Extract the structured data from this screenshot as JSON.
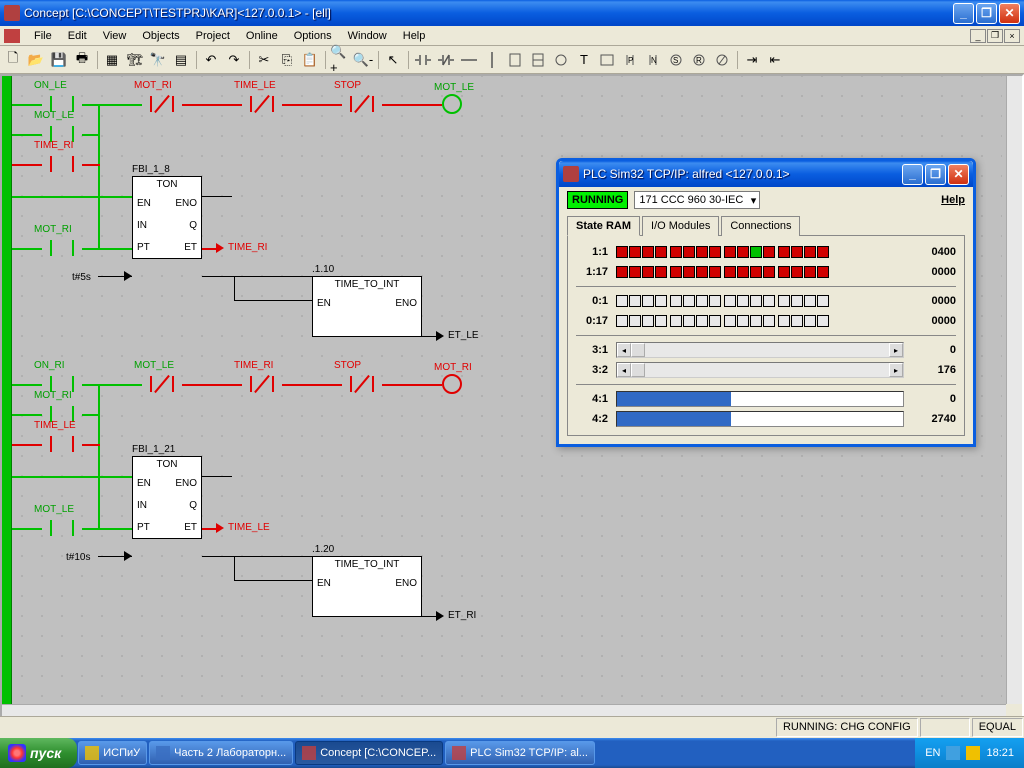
{
  "app": {
    "title": "Concept [C:\\CONCEPT\\TESTPRJ\\KAR]<127.0.0.1> - [ell]"
  },
  "menu": [
    "File",
    "Edit",
    "View",
    "Objects",
    "Project",
    "Online",
    "Options",
    "Window",
    "Help"
  ],
  "status": {
    "running": "RUNNING: CHG CONFIG",
    "equal": "EQUAL"
  },
  "plc": {
    "title": "PLC Sim32  TCP/IP: alfred <127.0.0.1>",
    "state": "RUNNING",
    "device": "171 CCC 960 30-IEC",
    "help": "Help",
    "tabs": [
      "State RAM",
      "I/O Modules",
      "Connections"
    ],
    "rows": {
      "r11": {
        "label": "1:1",
        "val": "0400",
        "bits": [
          1,
          1,
          1,
          1,
          1,
          1,
          1,
          1,
          1,
          1,
          2,
          1,
          1,
          1,
          1,
          1
        ]
      },
      "r117": {
        "label": "1:17",
        "val": "0000",
        "bits": [
          1,
          1,
          1,
          1,
          1,
          1,
          1,
          1,
          1,
          1,
          1,
          1,
          1,
          1,
          1,
          1
        ]
      },
      "r01": {
        "label": "0:1",
        "val": "0000",
        "bits": [
          0,
          0,
          0,
          0,
          0,
          0,
          0,
          0,
          0,
          0,
          0,
          0,
          0,
          0,
          0,
          0
        ]
      },
      "r017": {
        "label": "0:17",
        "val": "0000",
        "bits": [
          0,
          0,
          0,
          0,
          0,
          0,
          0,
          0,
          0,
          0,
          0,
          0,
          0,
          0,
          0,
          0
        ]
      },
      "r31": {
        "label": "3:1",
        "val": "0"
      },
      "r32": {
        "label": "3:2",
        "val": "176"
      },
      "r41": {
        "label": "4:1",
        "val": "0",
        "pct": 40
      },
      "r42": {
        "label": "4:2",
        "val": "2740",
        "pct": 40
      }
    }
  },
  "labels": {
    "ON_LE": "ON_LE",
    "MOT_RI": "MOT_RI",
    "TIME_LE": "TIME_LE",
    "STOP": "STOP",
    "MOT_LE": "MOT_LE",
    "TIME_RI": "TIME_RI",
    "ON_RI": "ON_RI",
    "FBI_1_8": "FBI_1_8",
    "FBI_1_21": "FBI_1_21",
    "TON": "TON",
    "EN": "EN",
    "ENO": "ENO",
    "IN": "IN",
    "Q": "Q",
    "PT": "PT",
    "ET": "ET",
    "TIME_TO_INT": "TIME_TO_INT",
    "ET_LE": "ET_LE",
    "ET_RI": "ET_RI",
    "t5s": "t#5s",
    "t10s": "t#10s",
    "n110": ".1.10",
    "n120": ".1.20"
  },
  "taskbar": {
    "start": "пуск",
    "items": [
      "ИСПиУ",
      "Часть 2 Лабораторн...",
      "Concept [C:\\CONCEP...",
      "PLC Sim32  TCP/IP: al..."
    ],
    "lang": "EN",
    "clock": "18:21"
  }
}
